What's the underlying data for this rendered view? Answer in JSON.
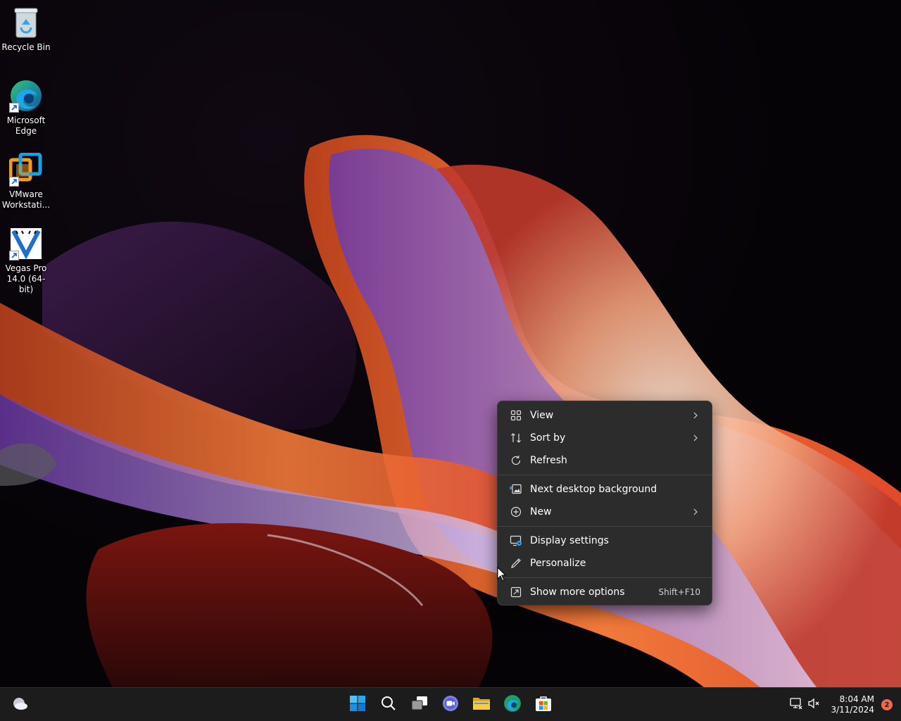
{
  "desktop": {
    "icons": [
      {
        "label": "Recycle Bin",
        "icon": "recycle-bin-icon"
      },
      {
        "label": "Microsoft\nEdge",
        "icon": "edge-icon"
      },
      {
        "label": "VMware\nWorkstati...",
        "icon": "vmware-icon"
      },
      {
        "label": "Vegas Pro\n14.0 (64-bit)",
        "icon": "vegas-pro-icon"
      }
    ]
  },
  "context_menu": {
    "items": [
      {
        "label": "View",
        "icon": "grid-view-icon",
        "submenu": true
      },
      {
        "label": "Sort by",
        "icon": "sort-icon",
        "submenu": true
      },
      {
        "label": "Refresh",
        "icon": "refresh-icon",
        "submenu": false
      },
      {
        "label": "Next desktop background",
        "icon": "next-background-icon",
        "submenu": false
      },
      {
        "label": "New",
        "icon": "new-plus-icon",
        "submenu": true
      },
      {
        "label": "Display settings",
        "icon": "display-settings-icon",
        "submenu": false
      },
      {
        "label": "Personalize",
        "icon": "pen-icon",
        "submenu": false
      },
      {
        "label": "Show more options",
        "icon": "show-more-icon",
        "shortcut": "Shift+F10"
      }
    ]
  },
  "taskbar": {
    "widgets_icon": "weather-cloud-icon",
    "pinned": [
      {
        "name": "Start",
        "icon": "windows-start-icon"
      },
      {
        "name": "Search",
        "icon": "search-icon"
      },
      {
        "name": "Task View",
        "icon": "task-view-icon"
      },
      {
        "name": "Chat",
        "icon": "teams-chat-icon"
      },
      {
        "name": "File Explorer",
        "icon": "folder-icon"
      },
      {
        "name": "Microsoft Edge",
        "icon": "edge-icon"
      },
      {
        "name": "Microsoft Store",
        "icon": "store-icon"
      }
    ],
    "tray": {
      "network_icon": "network-icon",
      "volume_icon": "volume-muted-icon",
      "time": "8:04 AM",
      "date": "3/11/2024",
      "notification_count": "2"
    }
  },
  "colors": {
    "menu_bg": "#2c2c2c",
    "taskbar_bg": "#1c1c1c",
    "windows_blue": "#2a9df4",
    "badge": "#ef6950"
  }
}
